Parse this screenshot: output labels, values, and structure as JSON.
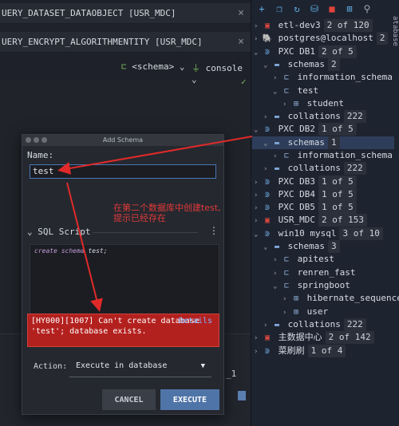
{
  "editor": {
    "tab1": "UERY_DATASET_DATAOBJECT [USR_MDC]",
    "tab2": "UERY_ENCRYPT_ALGORITHMENTITY [USR_MDC]",
    "schema": "<schema>",
    "console": "console",
    "bottom_text": "_1"
  },
  "tree": {
    "side_label": "atabase",
    "rows": [
      {
        "label": "etl-dev3",
        "count": "2 of 120"
      },
      {
        "label": "postgres@localhost",
        "count": "2"
      },
      {
        "label": "PXC DB1",
        "count": "2 of 5"
      },
      {
        "label": "schemas",
        "count": "2"
      },
      {
        "label": "information_schema",
        "count": ""
      },
      {
        "label": "test",
        "count": ""
      },
      {
        "label": "student",
        "count": ""
      },
      {
        "label": "collations",
        "count": "222"
      },
      {
        "label": "PXC DB2",
        "count": "1 of 5"
      },
      {
        "label": "schemas",
        "count": "1"
      },
      {
        "label": "information_schema",
        "count": ""
      },
      {
        "label": "collations",
        "count": "222"
      },
      {
        "label": "PXC DB3",
        "count": "1 of 5"
      },
      {
        "label": "PXC DB4",
        "count": "1 of 5"
      },
      {
        "label": "PXC DB5",
        "count": "1 of 5"
      },
      {
        "label": "USR_MDC",
        "count": "2 of 153"
      },
      {
        "label": "win10 mysql",
        "count": "3 of 10"
      },
      {
        "label": "schemas",
        "count": "3"
      },
      {
        "label": "apitest",
        "count": ""
      },
      {
        "label": "renren_fast",
        "count": ""
      },
      {
        "label": "springboot",
        "count": ""
      },
      {
        "label": "hibernate_sequence",
        "count": ""
      },
      {
        "label": "user",
        "count": ""
      },
      {
        "label": "collations",
        "count": "222"
      },
      {
        "label": "主数据中心",
        "count": "2 of 142"
      },
      {
        "label": "菜刷刷",
        "count": "1 of 4"
      }
    ]
  },
  "dialog": {
    "title": "Add Schema",
    "name_label": "Name:",
    "name_value": "test",
    "sql_label": "SQL Script",
    "sql_keyword": "create schema",
    "sql_ident": "test;",
    "error_text": "[HY000][1007] Can't create database 'test'; database exists.",
    "details": "Details",
    "action_label": "Action:",
    "action_value": "Execute in database",
    "cancel": "CANCEL",
    "execute": "EXECUTE"
  },
  "annotation": {
    "line1": "在第二个数据库中创建test,",
    "line2": "提示已经存在"
  }
}
